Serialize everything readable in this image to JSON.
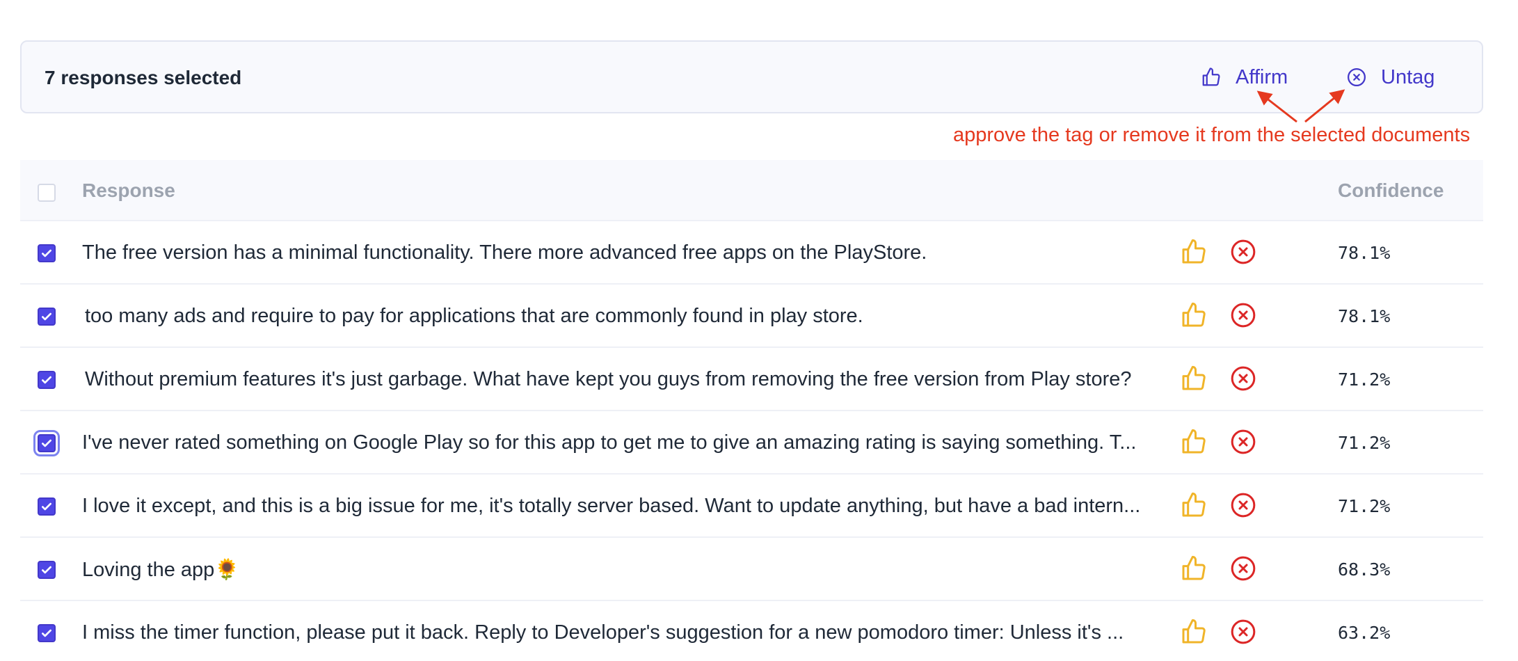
{
  "selection_bar": {
    "title": "7 responses selected",
    "affirm_label": "Affirm",
    "untag_label": "Untag"
  },
  "annotation": {
    "text": "approve the tag or remove it from the selected documents",
    "color": "#e5391f"
  },
  "table": {
    "headers": {
      "response": "Response",
      "confidence": "Confidence"
    },
    "rows": [
      {
        "text": "The free version has a minimal functionality. There more advanced free apps on the PlayStore.",
        "confidence": "78.1%",
        "checked": true
      },
      {
        "text": "too many ads and require to pay for applications that are commonly found in play store.",
        "confidence": "78.1%",
        "checked": true
      },
      {
        "text": "Without premium features it's just garbage. What have kept you guys from removing the free version from Play store?",
        "confidence": "71.2%",
        "checked": true
      },
      {
        "text": "I've never rated something on Google Play so for this app to get me to give an amazing rating is saying something. T...",
        "confidence": "71.2%",
        "checked": true
      },
      {
        "text": "I love it except, and this is a big issue for me, it's totally server based. Want to update anything, but have a bad intern...",
        "confidence": "71.2%",
        "checked": true
      },
      {
        "text": "Loving the app🌻",
        "confidence": "68.3%",
        "checked": true
      },
      {
        "text": "I miss the timer function, please put it back. Reply to Developer's suggestion for a new pomodoro timer: Unless it's ...",
        "confidence": "63.2%",
        "checked": true
      }
    ]
  },
  "icons": {
    "affirm": "thumbs-up-icon",
    "untag": "x-circle-icon",
    "checkbox": "checkmark-icon"
  },
  "colors": {
    "accent": "#4338ca",
    "checkbox": "#4f46e5",
    "thumbs_up": "#f0b429",
    "untag_red": "#dc2626",
    "header_text": "#9ca3af"
  }
}
